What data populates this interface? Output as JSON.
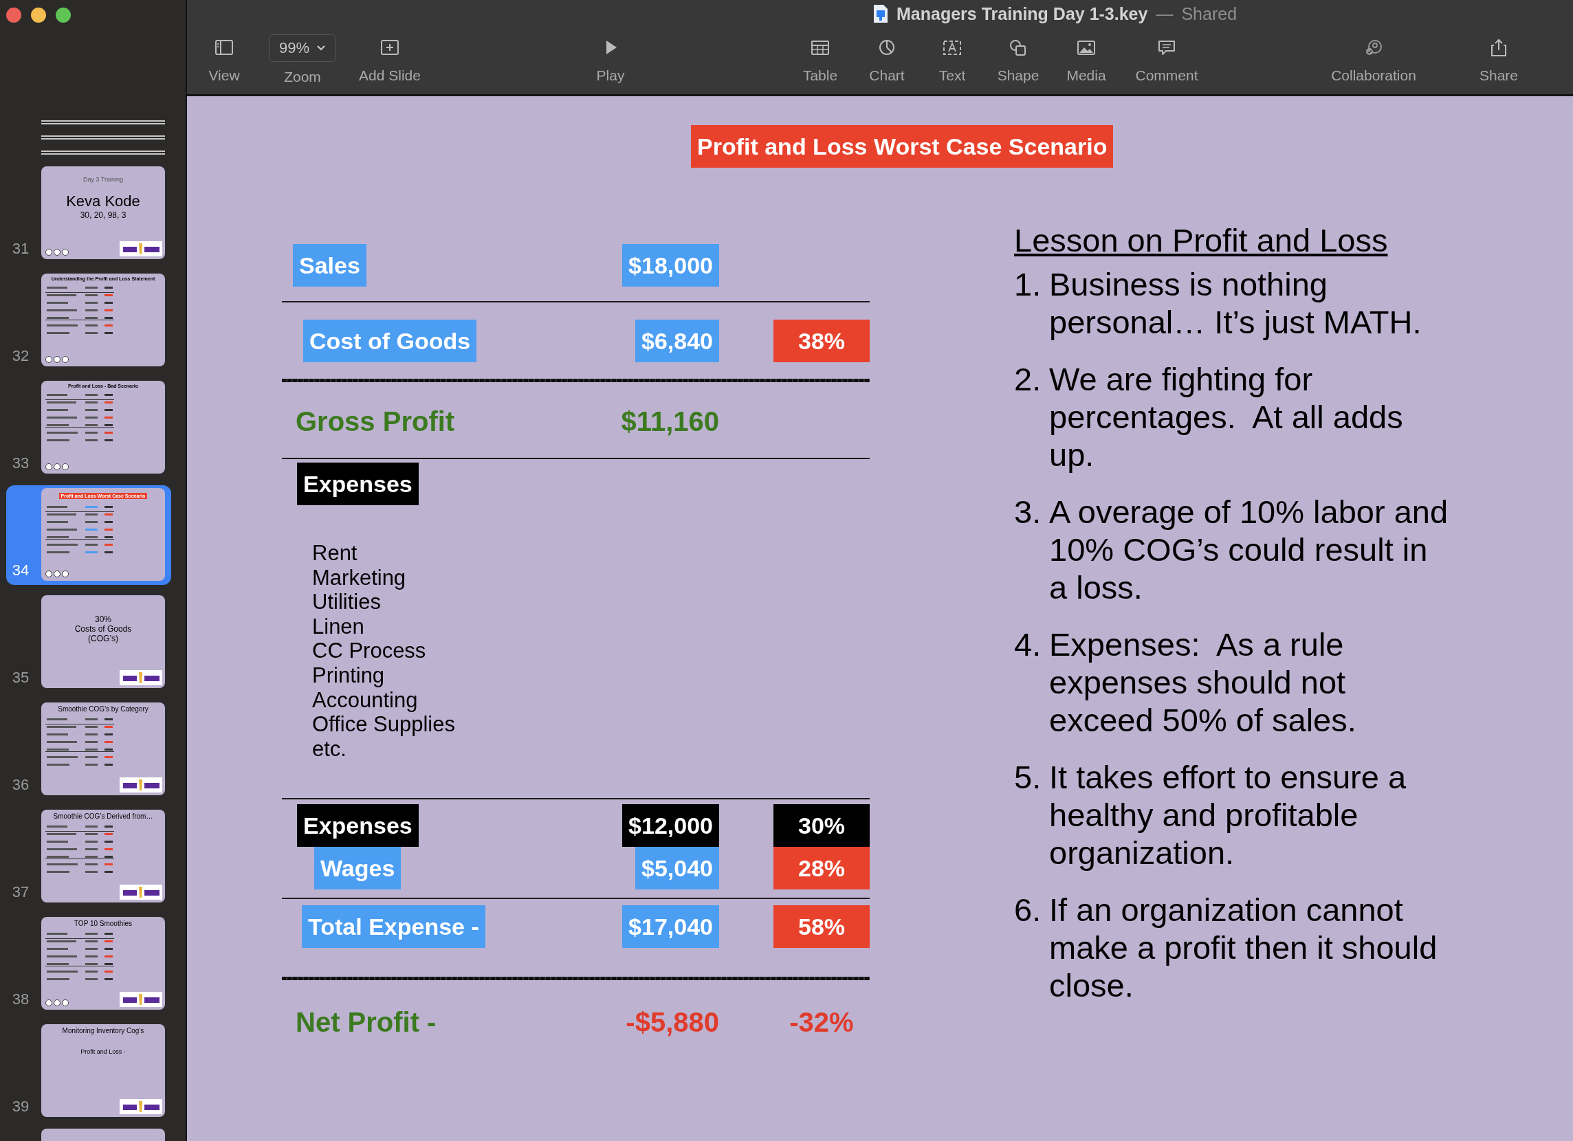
{
  "window": {
    "title": "Managers Training Day 1-3.key",
    "separator": "—",
    "status": "Shared"
  },
  "toolbar": [
    {
      "kind": "view",
      "label": "View"
    },
    {
      "kind": "zoom",
      "label": "Zoom",
      "value": "99%"
    },
    {
      "kind": "add-slide",
      "label": "Add Slide"
    },
    {
      "kind": "play",
      "label": "Play"
    },
    {
      "kind": "table",
      "label": "Table"
    },
    {
      "kind": "chart",
      "label": "Chart"
    },
    {
      "kind": "text",
      "label": "Text"
    },
    {
      "kind": "shape",
      "label": "Shape"
    },
    {
      "kind": "media",
      "label": "Media"
    },
    {
      "kind": "comment",
      "label": "Comment"
    },
    {
      "kind": "collaboration",
      "label": "Collaboration"
    },
    {
      "kind": "share",
      "label": "Share"
    }
  ],
  "sidebar": {
    "slides": [
      {
        "kind": "skipped"
      },
      {
        "kind": "skipped"
      },
      {
        "kind": "skipped"
      },
      {
        "kind": "cover",
        "number": "31",
        "selected": false,
        "kicker": "Day 3 Training",
        "lines": [
          "Keva Kode",
          "30, 20, 98, 3"
        ],
        "build_marks": true,
        "logo": true
      },
      {
        "kind": "document",
        "number": "32",
        "selected": false,
        "title": "Understanding the Profit and Loss Statement",
        "build_marks": true,
        "logo": false
      },
      {
        "kind": "document",
        "number": "33",
        "selected": false,
        "title": "Profit and Loss - Bad Scenario",
        "build_marks": true,
        "logo": false
      },
      {
        "kind": "document",
        "number": "34",
        "selected": true,
        "title": "Profit and Loss Worst Case Scenario",
        "build_marks": true,
        "logo": false
      },
      {
        "kind": "cover",
        "number": "35",
        "selected": false,
        "lines": [
          "30%",
          "Costs of Goods",
          "(COG’s)"
        ],
        "build_marks": false,
        "logo": true
      },
      {
        "kind": "document",
        "number": "36",
        "selected": false,
        "title": "Smoothie COG’s by Category",
        "build_marks": false,
        "logo": true
      },
      {
        "kind": "document",
        "number": "37",
        "selected": false,
        "title": "Smoothie COG’s Derived from…",
        "build_marks": false,
        "logo": true
      },
      {
        "kind": "document",
        "number": "38",
        "selected": false,
        "title": "TOP 10 Smoothies",
        "build_marks": true,
        "logo": true
      },
      {
        "kind": "document",
        "number": "39",
        "selected": false,
        "title": "Monitoring Inventory Cog’s",
        "note": "Profit and Loss -",
        "build_marks": false,
        "logo": true
      },
      {
        "kind": "partial"
      }
    ]
  },
  "slide": {
    "title": "Profit and Loss Worst Case Scenario",
    "rows": [
      {
        "kind": "line",
        "cells": [
          {
            "kind": "box",
            "color": "#4c9ef2",
            "text": "Sales"
          },
          {
            "kind": "box",
            "color": "#4c9ef2",
            "text": "$18,000"
          }
        ]
      },
      {
        "kind": "rule",
        "thick": false
      },
      {
        "kind": "line",
        "cells": [
          {
            "kind": "box",
            "color": "#4c9ef2",
            "text": "Cost of Goods"
          },
          {
            "kind": "box",
            "color": "#4c9ef2",
            "text": "$6,840"
          },
          {
            "kind": "box",
            "color": "#e8422d",
            "text": "38%"
          }
        ]
      },
      {
        "kind": "rule",
        "thick": true
      },
      {
        "kind": "line",
        "cells": [
          {
            "kind": "text",
            "color": "#3c7a1f",
            "text": "Gross Profit"
          },
          {
            "kind": "text",
            "color": "#3c7a1f",
            "text": "$11,160"
          }
        ]
      },
      {
        "kind": "rule",
        "thick": false
      },
      {
        "kind": "line",
        "cells": [
          {
            "kind": "box",
            "color": "#000000",
            "text": "Expenses"
          }
        ]
      },
      {
        "kind": "list",
        "items": [
          "Rent",
          "Marketing",
          "Utilities",
          "Linen",
          "CC Process",
          "Printing",
          "Accounting",
          "Office Supplies",
          "etc."
        ]
      },
      {
        "kind": "rule",
        "thick": false
      },
      {
        "kind": "line",
        "cells": [
          {
            "kind": "box",
            "color": "#000000",
            "text": "Expenses"
          },
          {
            "kind": "box",
            "color": "#000000",
            "text": "$12,000"
          },
          {
            "kind": "box",
            "color": "#000000",
            "text": "30%"
          }
        ]
      },
      {
        "kind": "line",
        "cells": [
          {
            "kind": "box",
            "color": "#4c9ef2",
            "text": "Wages"
          },
          {
            "kind": "box",
            "color": "#4c9ef2",
            "text": "$5,040"
          },
          {
            "kind": "box",
            "color": "#e8422d",
            "text": "28%"
          }
        ]
      },
      {
        "kind": "rule",
        "thick": false
      },
      {
        "kind": "line",
        "cells": [
          {
            "kind": "box",
            "color": "#4c9ef2",
            "text": "Total Expense -"
          },
          {
            "kind": "box",
            "color": "#4c9ef2",
            "text": "$17,040"
          },
          {
            "kind": "box",
            "color": "#e8422d",
            "text": "58%"
          }
        ]
      },
      {
        "kind": "rule",
        "thick": true
      },
      {
        "kind": "line",
        "cells": [
          {
            "kind": "text",
            "color": "#3c7a1f",
            "text": "Net Profit -"
          },
          {
            "kind": "text",
            "color": "#e03b2b",
            "text": "-$5,880"
          },
          {
            "kind": "text",
            "color": "#e03b2b",
            "text": "-32%"
          }
        ]
      }
    ],
    "lesson": {
      "title": "Lesson on Profit and Loss",
      "items": [
        {
          "number": "1.",
          "text": "Business is nothing personal… It’s just MATH."
        },
        {
          "number": "2.",
          "text": "We are fighting for percentages.  At all adds up."
        },
        {
          "number": "3.",
          "text": "A overage of 10% labor and 10% COG’s could result in a loss."
        },
        {
          "number": "4.",
          "text": "Expenses:  As a rule expenses should not exceed 50% of sales."
        },
        {
          "number": "5.",
          "text": "It takes effort to ensure a healthy and profitable organization."
        },
        {
          "number": "6.",
          "text": "If an organization cannot make a profit then it should close."
        }
      ]
    }
  }
}
